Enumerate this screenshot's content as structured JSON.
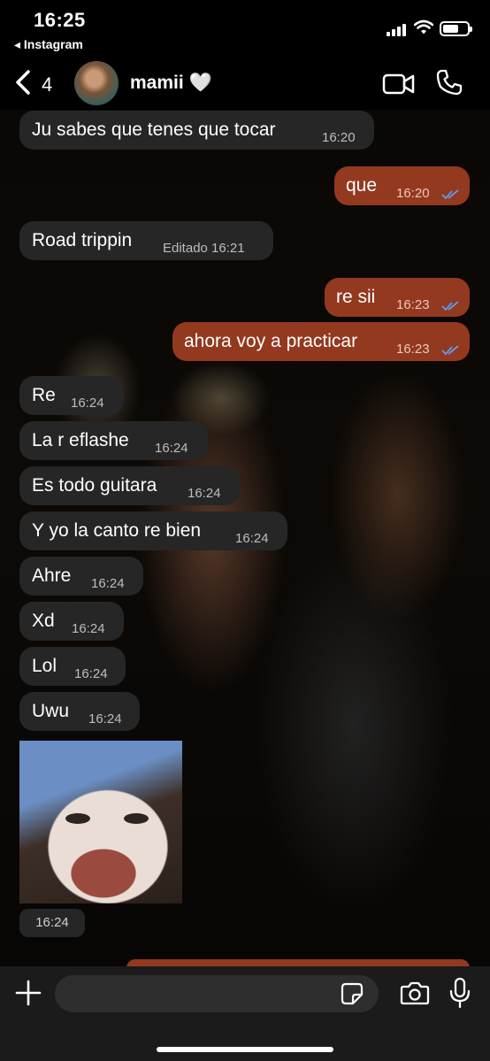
{
  "status_bar": {
    "time": "16:25",
    "back_app": "◂ Instagram"
  },
  "header": {
    "back_count": "4",
    "contact_name": "mamii 🤍"
  },
  "messages": [
    {
      "direction": "in",
      "text": "Ju sabes que tenes que tocar",
      "time": "16:20"
    },
    {
      "direction": "out",
      "text": "que",
      "time": "16:20",
      "read": true
    },
    {
      "direction": "in",
      "text": "Road trippin",
      "time": "Editado 16:21"
    },
    {
      "direction": "out",
      "text": "re sii",
      "time": "16:23",
      "read": true
    },
    {
      "direction": "out",
      "text": "ahora voy a practicar",
      "time": "16:23",
      "read": true
    },
    {
      "direction": "in",
      "text": "Re",
      "time": "16:24"
    },
    {
      "direction": "in",
      "text": "La r eflashe",
      "time": "16:24"
    },
    {
      "direction": "in",
      "text": "Es todo guitara",
      "time": "16:24"
    },
    {
      "direction": "in",
      "text": "Y yo la canto re bien",
      "time": "16:24"
    },
    {
      "direction": "in",
      "text": "Ahre",
      "time": "16:24"
    },
    {
      "direction": "in",
      "text": "Xd",
      "time": "16:24"
    },
    {
      "direction": "in",
      "text": "Lol",
      "time": "16:24"
    },
    {
      "direction": "in",
      "text": "Uwu",
      "time": "16:24"
    }
  ],
  "photo_message": {
    "time": "16:24"
  },
  "colors": {
    "incoming_bubble": "#262626",
    "outgoing_bubble": "#93391f",
    "read_ticks": "#5f9bf2"
  }
}
